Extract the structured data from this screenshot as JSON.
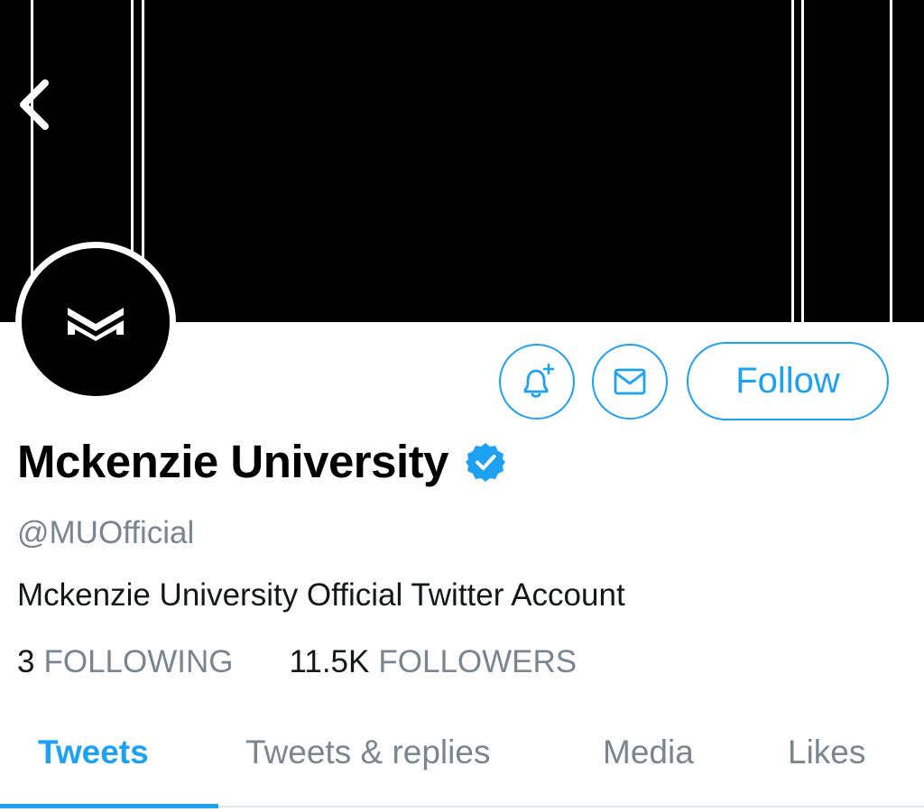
{
  "profile": {
    "display_name": "Mckenzie University",
    "handle": "@MUOfficial",
    "bio": "Mckenzie University Official Twitter Account",
    "verified": true
  },
  "actions": {
    "follow_label": "Follow",
    "notify_icon": "bell-plus-icon",
    "message_icon": "envelope-icon"
  },
  "stats": {
    "following_count": "3",
    "following_label": "FOLLOWING",
    "followers_count": "11.5K",
    "followers_label": "FOLLOWERS"
  },
  "tabs": [
    {
      "label": "Tweets",
      "active": true
    },
    {
      "label": "Tweets & replies",
      "active": false
    },
    {
      "label": "Media",
      "active": false
    },
    {
      "label": "Likes",
      "active": false
    }
  ],
  "colors": {
    "accent": "#1da1f2",
    "muted": "#7a868f",
    "text": "#14171a",
    "banner": "#000000"
  },
  "icons": {
    "back": "chevron-left-icon",
    "verified": "verified-badge-icon",
    "avatar_logo": "mu-logo"
  }
}
